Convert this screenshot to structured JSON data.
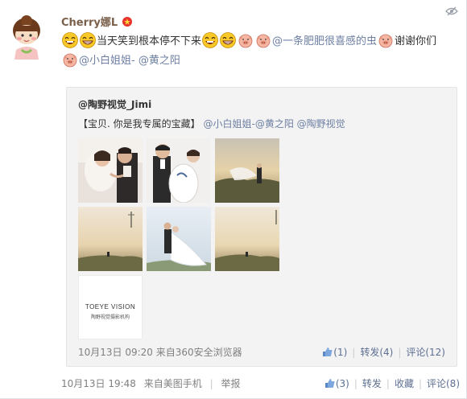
{
  "post": {
    "nickname": "Cherry娜L",
    "text_1": "当天笑到根本停不下来",
    "text_2": "一条肥肥很喜感的虫",
    "text_3": "谢谢你们",
    "mention_1": "@一条肥肥很喜感的虫",
    "mention_2": "@小白姐姐-",
    "mention_3": "@黄之阳",
    "time": "10月13日 19:48",
    "source": "来自美图手机",
    "report_label": "举报",
    "like_count": "(3)",
    "repost_label": "转发",
    "favorite_label": "收藏",
    "comment_label": "评论(8)"
  },
  "repost": {
    "author": "@陶野视觉_Jimi",
    "text": "【宝贝. 你是我专属的宝藏】",
    "mention_1": "@小白姐姐-",
    "mention_2": "@黄之阳",
    "mention_3": "@陶野视觉",
    "time": "10月13日 09:20",
    "source": "来自360安全浏览器",
    "like_count": "(1)",
    "repost_label": "转发(4)",
    "comment_label": "评论(12)",
    "logo_title": "TOEYE VISION",
    "logo_subtitle": "陶野视觉摄影机构"
  },
  "icons": [
    "hide-icon",
    "vip-icon",
    "laugh-emoticon",
    "grin-emoticon",
    "pig-emoticon",
    "like-icon"
  ],
  "colors": {
    "nickname": "#7a5f4a",
    "mention": "#6d7fa3",
    "link": "#5d6f93",
    "meta": "#808080",
    "repost_bg": "#f3f3f3"
  }
}
